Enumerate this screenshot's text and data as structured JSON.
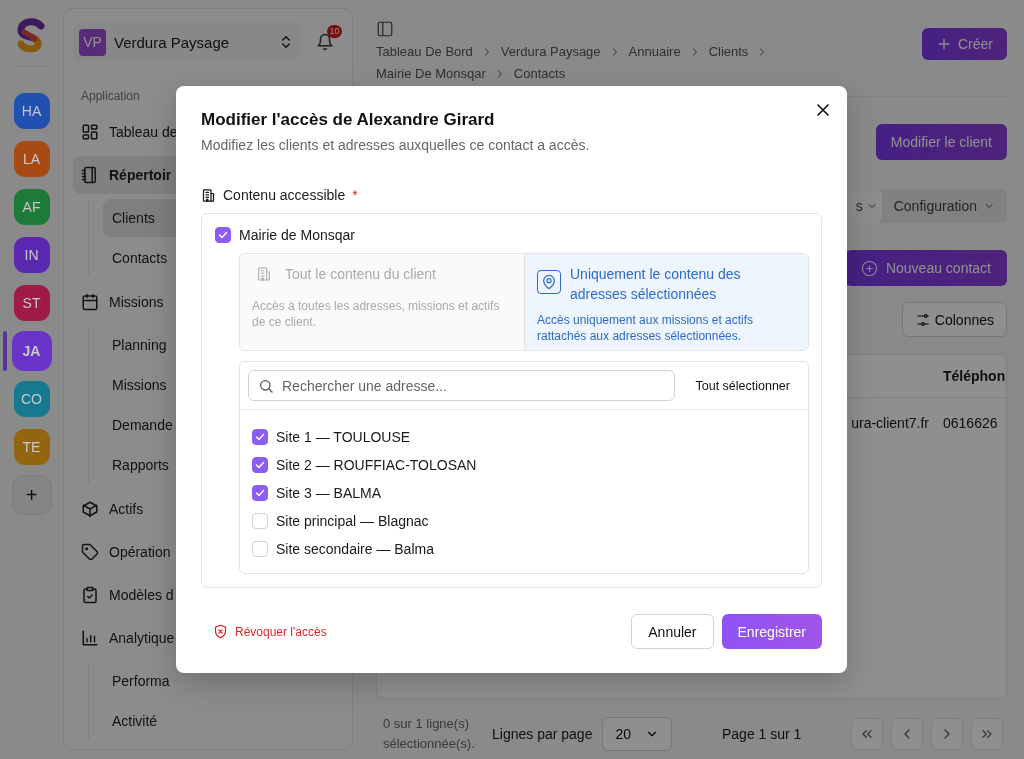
{
  "rail": {
    "avatars": [
      {
        "initials": "HA",
        "color": "#2050b0",
        "selected": false
      },
      {
        "initials": "LA",
        "color": "#a84a14",
        "selected": false
      },
      {
        "initials": "AF",
        "color": "#1e7a38",
        "selected": false
      },
      {
        "initials": "IN",
        "color": "#5a28b0",
        "selected": false
      },
      {
        "initials": "ST",
        "color": "#a01a48",
        "selected": false
      },
      {
        "initials": "JA",
        "color": "#6a34c8",
        "selected": true
      },
      {
        "initials": "CO",
        "color": "#157a90",
        "selected": false
      },
      {
        "initials": "TE",
        "color": "#94650f",
        "selected": false
      }
    ],
    "add_button": "+"
  },
  "workspace": {
    "initials": "VP",
    "name": "Verdura Paysage"
  },
  "notifications": {
    "count": "10"
  },
  "sidebar": {
    "section": "Application",
    "items": [
      {
        "label": "Tableau de",
        "selected": false
      },
      {
        "label": "Répertoir",
        "selected": true,
        "children": [
          {
            "label": "Clients",
            "selected": true
          },
          {
            "label": "Contacts",
            "selected": false
          }
        ]
      },
      {
        "label": "Missions",
        "selected": false,
        "children": [
          {
            "label": "Planning",
            "selected": false
          },
          {
            "label": "Missions",
            "selected": false
          },
          {
            "label": "Demande",
            "selected": false
          },
          {
            "label": "Rapports",
            "selected": false
          }
        ]
      },
      {
        "label": "Actifs",
        "selected": false
      },
      {
        "label": "Opération",
        "selected": false
      },
      {
        "label": "Modèles d",
        "selected": false
      },
      {
        "label": "Analytique",
        "selected": false,
        "children": [
          {
            "label": "Performa",
            "selected": false
          },
          {
            "label": "Activité",
            "selected": false
          }
        ]
      }
    ]
  },
  "breadcrumb": [
    "Tableau De Bord",
    "Verdura Paysage",
    "Annuaire",
    "Clients",
    "Mairie De Monsqar",
    "Contacts"
  ],
  "create_button": "Créer",
  "edit_client_button": "Modifier le client",
  "tabs": [
    {
      "label": "s",
      "selected": true
    },
    {
      "label": "Configuration",
      "selected": false
    }
  ],
  "new_contact_button": "Nouveau contact",
  "columns_button": "Colonnes",
  "table": {
    "columns": [
      {},
      {
        "label": "Téléphon"
      }
    ],
    "rows": [
      {
        "cells": [
          "ura-client7.fr",
          "0616626"
        ]
      }
    ]
  },
  "pagination": {
    "selection": "0 sur 1 ligne(s) sélectionnée(s).",
    "rows_label": "Lignes par page",
    "page_size": "20",
    "page_info": "Page 1 sur 1"
  },
  "dialog": {
    "title": "Modifier l'accès de Alexandre Girard",
    "description": "Modifiez les clients et adresses auxquelles ce contact a accès.",
    "section_label": "Contenu accessible",
    "required_mark": "*",
    "clients": [
      {
        "name": "Mairie de Monsqar",
        "checked": true,
        "scope_options": [
          {
            "title": "Tout le contenu du client",
            "description": "Accès à toutes les adresses, missions et actifs de ce client.",
            "selected": false
          },
          {
            "title": "Uniquement le contenu des adresses sélectionnées",
            "description": "Accès uniquement aux missions et actifs rattachés aux adresses sélectionnées.",
            "selected": true
          }
        ],
        "address_search": {
          "placeholder": "Rechercher une adresse..."
        },
        "select_all": "Tout sélectionner",
        "addresses": [
          {
            "label": "Site 1 — TOULOUSE",
            "checked": true
          },
          {
            "label": "Site 2 — ROUFFIAC-TOLOSAN",
            "checked": true
          },
          {
            "label": "Site 3 — BALMA",
            "checked": true
          },
          {
            "label": "Site principal — Blagnac",
            "checked": false
          },
          {
            "label": "Site secondaire — Balma",
            "checked": false
          }
        ]
      }
    ],
    "revoke": "Révoquer l'accès",
    "cancel": "Annuler",
    "save": "Enregistrer"
  }
}
